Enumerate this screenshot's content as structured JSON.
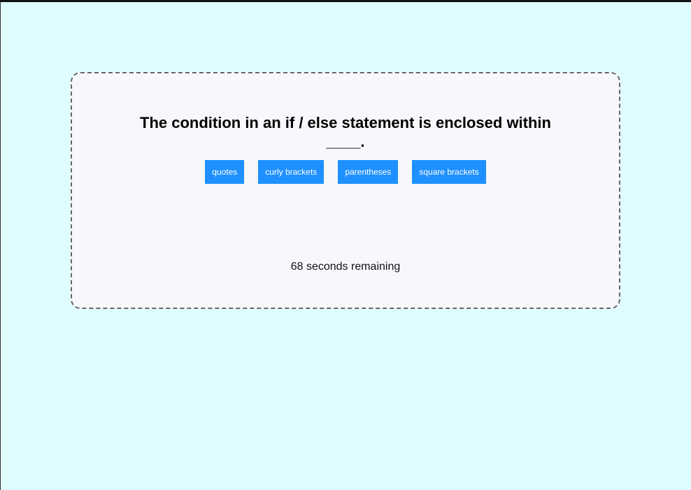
{
  "quiz": {
    "question": "The condition in an if / else statement is enclosed within ____.",
    "choices": [
      "quotes",
      "curly brackets",
      "parentheses",
      "square brackets"
    ],
    "timer_text": "68 seconds remaining"
  },
  "colors": {
    "page_background": "#dffdfe",
    "card_background": "#f7f8fc",
    "button_background": "#1e90ff",
    "button_text": "#ffffff"
  }
}
